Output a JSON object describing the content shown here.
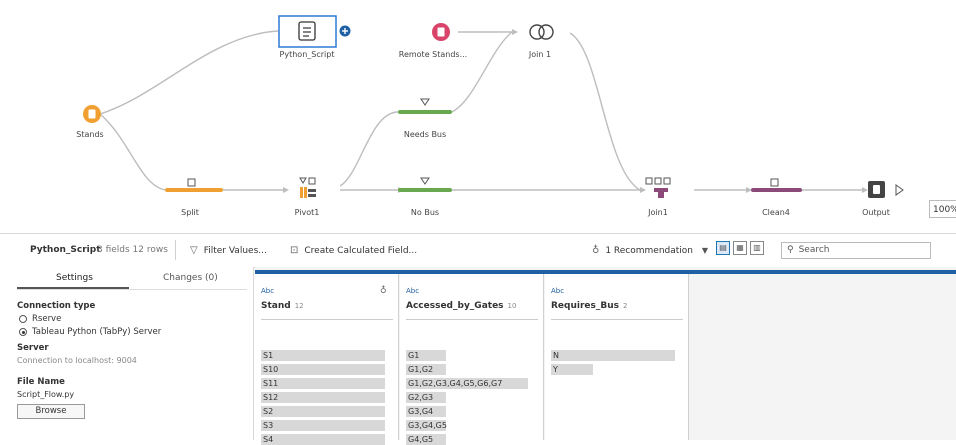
{
  "flow": {
    "nodes": {
      "stands": "Stands",
      "python_script": "Python_Script",
      "remote_stands": "Remote Stands...",
      "join1_top": "Join 1",
      "needs_bus": "Needs Bus",
      "split": "Split",
      "pivot1": "Pivot1",
      "no_bus": "No Bus",
      "join1": "Join1",
      "clean4": "Clean4",
      "output": "Output"
    },
    "zoom": "100%"
  },
  "toolbar": {
    "step_name": "Python_Script",
    "step_meta": "3 fields  12 rows",
    "filter_values": "Filter Values...",
    "create_calc": "Create Calculated Field...",
    "recommendation": "1 Recommendation",
    "search_placeholder": "Search"
  },
  "settings": {
    "tab_settings": "Settings",
    "tab_changes": "Changes (0)",
    "connection_type_title": "Connection type",
    "option_rserve": "Rserve",
    "option_tabpy": "Tableau Python (TabPy) Server",
    "server_title": "Server",
    "server_value": "Connection to localhost: 9004",
    "file_name_title": "File Name",
    "file_name_value": "Script_Flow.py",
    "browse": "Browse"
  },
  "columns": [
    {
      "type": "Abc",
      "name": "Stand",
      "count": "12",
      "values": [
        "S1",
        "S10",
        "S11",
        "S12",
        "S2",
        "S3",
        "S4"
      ]
    },
    {
      "type": "Abc",
      "name": "Accessed_by_Gates",
      "count": "10",
      "values": [
        "G1",
        "G1,G2",
        "G1,G2,G3,G4,G5,G6,G7",
        "G2,G3",
        "G3,G4",
        "G3,G4,G5",
        "G4,G5"
      ]
    },
    {
      "type": "Abc",
      "name": "Requires_Bus",
      "count": "2",
      "values": [
        "N",
        "Y"
      ]
    }
  ],
  "colors": {
    "accent": "#1f5fa3",
    "orange": "#f0a030",
    "green": "#6aa84f",
    "pink": "#d9456a",
    "purple": "#8c4a7a",
    "output": "#444444"
  }
}
